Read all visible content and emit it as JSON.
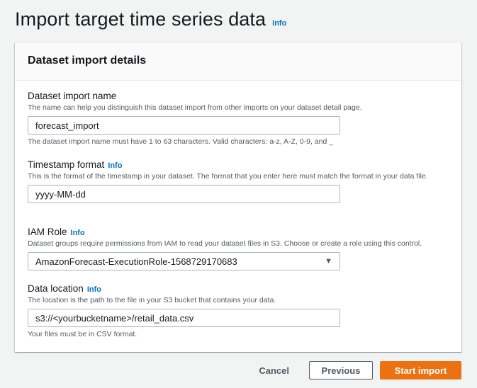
{
  "header": {
    "title": "Import target time series data",
    "info": "Info"
  },
  "panel": {
    "title": "Dataset import details"
  },
  "fields": {
    "import_name": {
      "label": "Dataset import name",
      "description": "The name can help you distinguish this dataset import from other imports on your dataset detail page.",
      "value": "forecast_import",
      "constraint": "The dataset import name must have 1 to 63 characters. Valid characters: a-z, A-Z, 0-9, and _"
    },
    "timestamp_format": {
      "label": "Timestamp format",
      "info": "Info",
      "description": "This is the format of the timestamp in your dataset. The format that you enter here must match the format in your data file.",
      "value": "yyyy-MM-dd"
    },
    "iam_role": {
      "label": "IAM Role",
      "info": "Info",
      "description": "Dataset groups require permissions from IAM to read your dataset files in S3. Choose or create a role using this control.",
      "value": "AmazonForecast-ExecutionRole-1568729170683"
    },
    "data_location": {
      "label": "Data location",
      "info": "Info",
      "description": "The location is the path to the file in your S3 bucket that contains your data.",
      "value": "s3://<yourbucketname>/retail_data.csv",
      "constraint": "Your files must be in CSV format."
    }
  },
  "actions": {
    "cancel": "Cancel",
    "previous": "Previous",
    "start": "Start import"
  },
  "colors": {
    "primary": "#ec7211",
    "link": "#0073bb"
  },
  "icons": {
    "select_caret": "caret-down-icon"
  }
}
